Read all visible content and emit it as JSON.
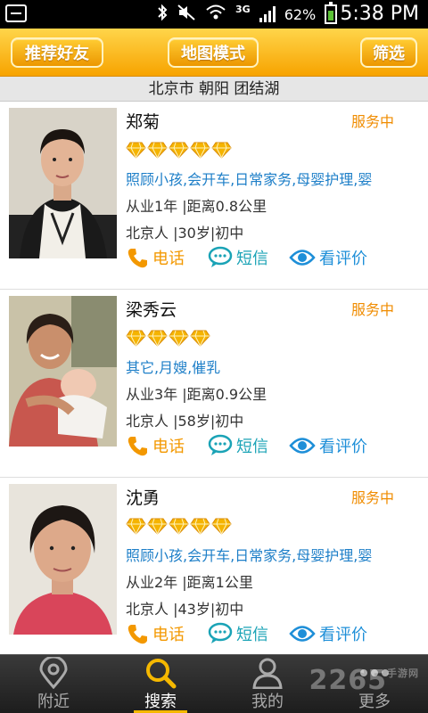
{
  "statusbar": {
    "network": "3G",
    "battery": "62%",
    "time": "5:38 PM"
  },
  "topbar": {
    "recommend_label": "推荐好友",
    "map_label": "地图模式",
    "filter_label": "筛选"
  },
  "location": "北京市 朝阳 团结湖",
  "providers": [
    {
      "name": "郑菊",
      "status": "服务中",
      "rating": 5,
      "tags": "照顾小孩,会开车,日常家务,母婴护理,婴",
      "meta1": "从业1年 |距离0.8公里",
      "meta2": "北京人 |30岁|初中",
      "actions": {
        "call": "电话",
        "sms": "短信",
        "review": "看评价"
      }
    },
    {
      "name": "梁秀云",
      "status": "服务中",
      "rating": 4,
      "tags": "其它,月嫂,催乳",
      "meta1": "从业3年 |距离0.9公里",
      "meta2": "北京人 |58岁|初中",
      "actions": {
        "call": "电话",
        "sms": "短信",
        "review": "看评价"
      }
    },
    {
      "name": "沈勇",
      "status": "服务中",
      "rating": 5,
      "tags": "照顾小孩,会开车,日常家务,母婴护理,婴",
      "meta1": "从业2年 |距离1公里",
      "meta2": "北京人 |43岁|初中",
      "actions": {
        "call": "电话",
        "sms": "短信",
        "review": "看评价"
      }
    }
  ],
  "bottomnav": {
    "nearby": "附近",
    "search": "搜索",
    "mine": "我的",
    "more": "更多",
    "active": "search"
  },
  "watermark": {
    "brand": "2265",
    "sub": "手游网"
  },
  "colors": {
    "accent": "#f7a300",
    "status": "#f08c00",
    "tags": "#1e7fc8",
    "diamond": "#f5b400"
  }
}
